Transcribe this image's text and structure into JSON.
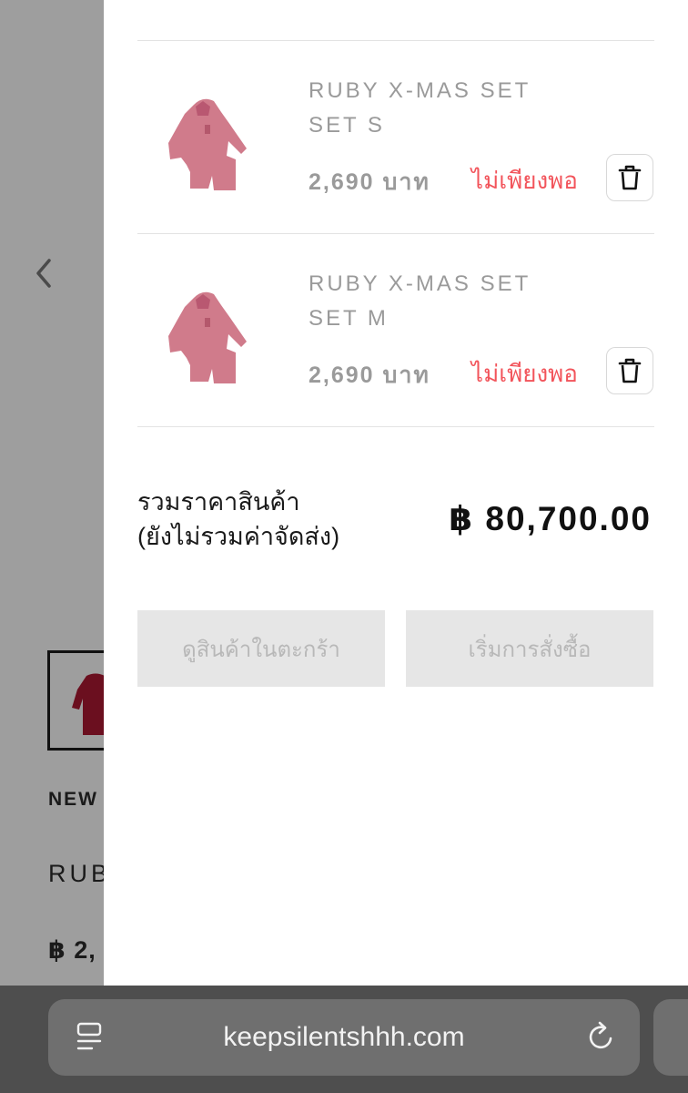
{
  "background_page": {
    "badge": "NEW",
    "product_name_partial": "RUB",
    "price_partial": "฿ 2,"
  },
  "cart": {
    "items": [
      {
        "name": "RUBY X-MAS SET",
        "variant": "SET S",
        "price": "2,690 บาท",
        "stock_status": "ไม่เพียงพอ",
        "delete_icon": "trash-icon"
      },
      {
        "name": "RUBY X-MAS SET",
        "variant": "SET M",
        "price": "2,690 บาท",
        "stock_status": "ไม่เพียงพอ",
        "delete_icon": "trash-icon"
      }
    ],
    "total_label_line1": "รวมราคาสินค้า",
    "total_label_line2": "(ยังไม่รวมค่าจัดส่ง)",
    "total_amount": "฿ 80,700.00",
    "view_cart_label": "ดูสินค้าในตะกร้า",
    "checkout_label": "เริ่มการสั่งซื้อ"
  },
  "browser": {
    "url": "keepsilentshhh.com",
    "left_icon": "tabs-list-icon",
    "right_icon": "reload-icon"
  },
  "colors": {
    "stock_warning": "#f2545b",
    "muted_text": "#9a9a9a",
    "disabled_button_bg": "#e6e6e6",
    "product_color": "#c04a5e"
  }
}
